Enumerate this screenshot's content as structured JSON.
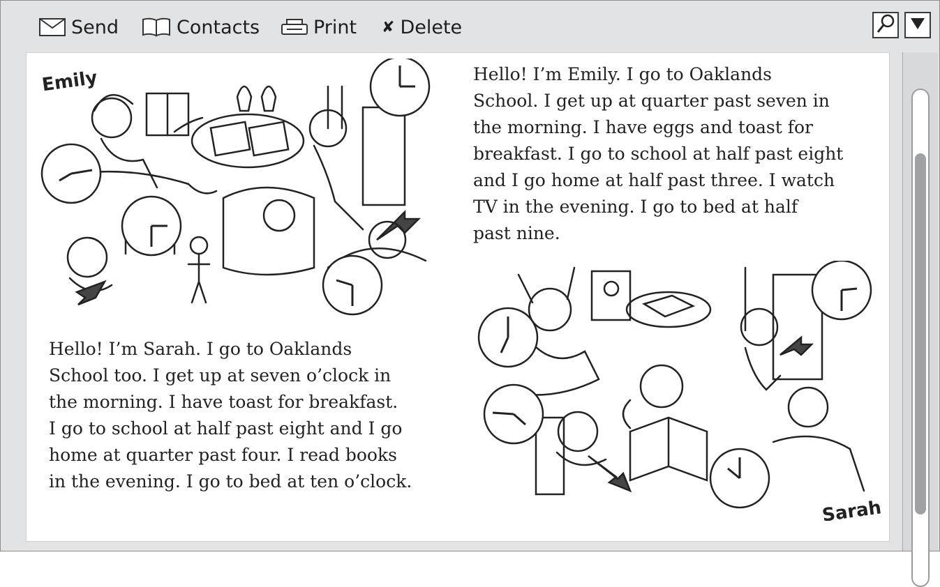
{
  "toolbar": {
    "send_label": "Send",
    "contacts_label": "Contacts",
    "print_label": "Print",
    "delete_label": "Delete",
    "icons": [
      "envelope-icon",
      "book-icon",
      "printer-icon",
      "delete-x-icon",
      "search-icon",
      "dropdown-arrow-icon"
    ]
  },
  "emily": {
    "name": "Emily",
    "lines": [
      "Hello! I’m Emily. I go to Oaklands",
      "School. I get up at quarter past seven in",
      "the morning. I have eggs and toast for",
      "breakfast. I go to school at half past eight",
      "and I go home at half past three. I watch",
      "TV in the evening. I go to bed at half",
      "past nine."
    ]
  },
  "sarah": {
    "name": "Sarah",
    "lines": [
      "Hello! I’m Sarah. I go to Oaklands",
      "School too. I get up at seven o’clock in",
      "the morning. I have toast for breakfast.",
      "I go to school at half past eight and I go",
      "home at quarter past four. I read books",
      "in the evening. I go to bed at ten o’clock."
    ]
  },
  "colors": {
    "window_bg": "#e2e3e4",
    "content_bg": "#ffffff",
    "scroll_thumb": "#9fa1a3",
    "text": "#222222"
  }
}
